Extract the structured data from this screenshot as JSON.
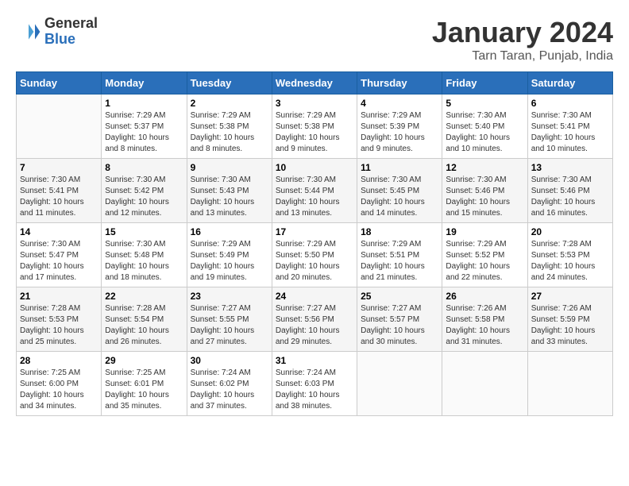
{
  "header": {
    "logo_general": "General",
    "logo_blue": "Blue",
    "month_title": "January 2024",
    "location": "Tarn Taran, Punjab, India"
  },
  "columns": [
    "Sunday",
    "Monday",
    "Tuesday",
    "Wednesday",
    "Thursday",
    "Friday",
    "Saturday"
  ],
  "weeks": [
    [
      {
        "day": "",
        "info": ""
      },
      {
        "day": "1",
        "info": "Sunrise: 7:29 AM\nSunset: 5:37 PM\nDaylight: 10 hours\nand 8 minutes."
      },
      {
        "day": "2",
        "info": "Sunrise: 7:29 AM\nSunset: 5:38 PM\nDaylight: 10 hours\nand 8 minutes."
      },
      {
        "day": "3",
        "info": "Sunrise: 7:29 AM\nSunset: 5:38 PM\nDaylight: 10 hours\nand 9 minutes."
      },
      {
        "day": "4",
        "info": "Sunrise: 7:29 AM\nSunset: 5:39 PM\nDaylight: 10 hours\nand 9 minutes."
      },
      {
        "day": "5",
        "info": "Sunrise: 7:30 AM\nSunset: 5:40 PM\nDaylight: 10 hours\nand 10 minutes."
      },
      {
        "day": "6",
        "info": "Sunrise: 7:30 AM\nSunset: 5:41 PM\nDaylight: 10 hours\nand 10 minutes."
      }
    ],
    [
      {
        "day": "7",
        "info": "Sunrise: 7:30 AM\nSunset: 5:41 PM\nDaylight: 10 hours\nand 11 minutes."
      },
      {
        "day": "8",
        "info": "Sunrise: 7:30 AM\nSunset: 5:42 PM\nDaylight: 10 hours\nand 12 minutes."
      },
      {
        "day": "9",
        "info": "Sunrise: 7:30 AM\nSunset: 5:43 PM\nDaylight: 10 hours\nand 13 minutes."
      },
      {
        "day": "10",
        "info": "Sunrise: 7:30 AM\nSunset: 5:44 PM\nDaylight: 10 hours\nand 13 minutes."
      },
      {
        "day": "11",
        "info": "Sunrise: 7:30 AM\nSunset: 5:45 PM\nDaylight: 10 hours\nand 14 minutes."
      },
      {
        "day": "12",
        "info": "Sunrise: 7:30 AM\nSunset: 5:46 PM\nDaylight: 10 hours\nand 15 minutes."
      },
      {
        "day": "13",
        "info": "Sunrise: 7:30 AM\nSunset: 5:46 PM\nDaylight: 10 hours\nand 16 minutes."
      }
    ],
    [
      {
        "day": "14",
        "info": "Sunrise: 7:30 AM\nSunset: 5:47 PM\nDaylight: 10 hours\nand 17 minutes."
      },
      {
        "day": "15",
        "info": "Sunrise: 7:30 AM\nSunset: 5:48 PM\nDaylight: 10 hours\nand 18 minutes."
      },
      {
        "day": "16",
        "info": "Sunrise: 7:29 AM\nSunset: 5:49 PM\nDaylight: 10 hours\nand 19 minutes."
      },
      {
        "day": "17",
        "info": "Sunrise: 7:29 AM\nSunset: 5:50 PM\nDaylight: 10 hours\nand 20 minutes."
      },
      {
        "day": "18",
        "info": "Sunrise: 7:29 AM\nSunset: 5:51 PM\nDaylight: 10 hours\nand 21 minutes."
      },
      {
        "day": "19",
        "info": "Sunrise: 7:29 AM\nSunset: 5:52 PM\nDaylight: 10 hours\nand 22 minutes."
      },
      {
        "day": "20",
        "info": "Sunrise: 7:28 AM\nSunset: 5:53 PM\nDaylight: 10 hours\nand 24 minutes."
      }
    ],
    [
      {
        "day": "21",
        "info": "Sunrise: 7:28 AM\nSunset: 5:53 PM\nDaylight: 10 hours\nand 25 minutes."
      },
      {
        "day": "22",
        "info": "Sunrise: 7:28 AM\nSunset: 5:54 PM\nDaylight: 10 hours\nand 26 minutes."
      },
      {
        "day": "23",
        "info": "Sunrise: 7:27 AM\nSunset: 5:55 PM\nDaylight: 10 hours\nand 27 minutes."
      },
      {
        "day": "24",
        "info": "Sunrise: 7:27 AM\nSunset: 5:56 PM\nDaylight: 10 hours\nand 29 minutes."
      },
      {
        "day": "25",
        "info": "Sunrise: 7:27 AM\nSunset: 5:57 PM\nDaylight: 10 hours\nand 30 minutes."
      },
      {
        "day": "26",
        "info": "Sunrise: 7:26 AM\nSunset: 5:58 PM\nDaylight: 10 hours\nand 31 minutes."
      },
      {
        "day": "27",
        "info": "Sunrise: 7:26 AM\nSunset: 5:59 PM\nDaylight: 10 hours\nand 33 minutes."
      }
    ],
    [
      {
        "day": "28",
        "info": "Sunrise: 7:25 AM\nSunset: 6:00 PM\nDaylight: 10 hours\nand 34 minutes."
      },
      {
        "day": "29",
        "info": "Sunrise: 7:25 AM\nSunset: 6:01 PM\nDaylight: 10 hours\nand 35 minutes."
      },
      {
        "day": "30",
        "info": "Sunrise: 7:24 AM\nSunset: 6:02 PM\nDaylight: 10 hours\nand 37 minutes."
      },
      {
        "day": "31",
        "info": "Sunrise: 7:24 AM\nSunset: 6:03 PM\nDaylight: 10 hours\nand 38 minutes."
      },
      {
        "day": "",
        "info": ""
      },
      {
        "day": "",
        "info": ""
      },
      {
        "day": "",
        "info": ""
      }
    ]
  ]
}
